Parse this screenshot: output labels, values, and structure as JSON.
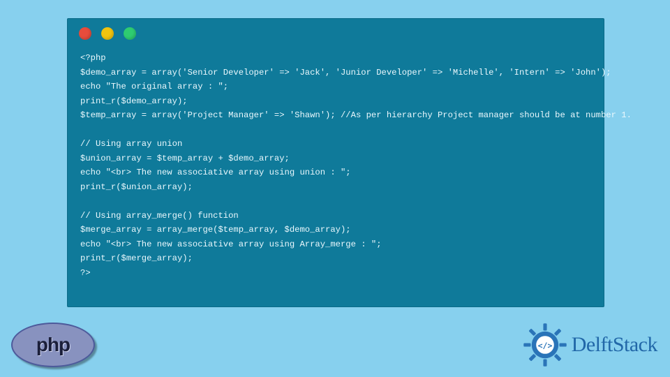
{
  "window": {
    "dots": [
      "red",
      "yellow",
      "green"
    ]
  },
  "code": {
    "lines": [
      "<?php",
      "$demo_array = array('Senior Developer' => 'Jack', 'Junior Developer' => 'Michelle', 'Intern' => 'John');",
      "echo \"The original array : \";",
      "print_r($demo_array);",
      "$temp_array = array('Project Manager' => 'Shawn'); //As per hierarchy Project manager should be at number 1.",
      "",
      "// Using array union",
      "$union_array = $temp_array + $demo_array;",
      "echo \"<br> The new associative array using union : \";",
      "print_r($union_array);",
      "",
      "// Using array_merge() function",
      "$merge_array = array_merge($temp_array, $demo_array);",
      "echo \"<br> The new associative array using Array_merge : \";",
      "print_r($merge_array);",
      "?>"
    ]
  },
  "logos": {
    "php_label": "php",
    "delft_label": "DelftStack"
  },
  "colors": {
    "page_bg": "#87d0ee",
    "window_bg": "#0f7a9a",
    "code_fg": "#eaf8fd",
    "php_bg": "#8892bf",
    "delft_fg": "#2167a8"
  }
}
